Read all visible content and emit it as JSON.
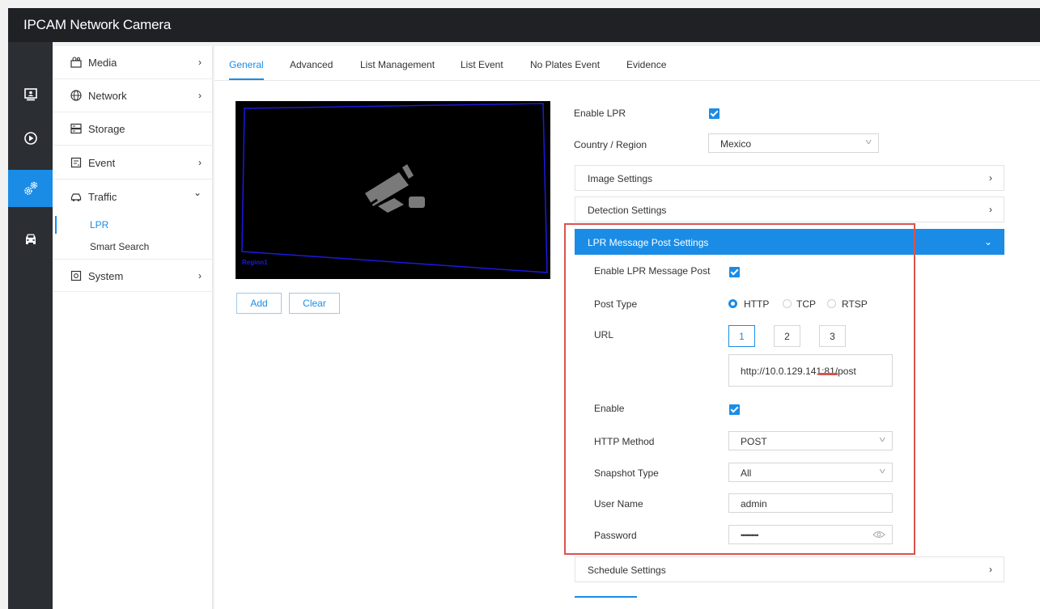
{
  "app": {
    "title": "IPCAM Network Camera"
  },
  "rail": [
    {
      "icon": "monitor-icon"
    },
    {
      "icon": "playback-icon"
    },
    {
      "icon": "settings-gears-icon"
    },
    {
      "icon": "vehicle-icon"
    }
  ],
  "menu": {
    "items": [
      {
        "label": "Media",
        "icon": "camera-media-icon",
        "chevron": "›"
      },
      {
        "label": "Network",
        "icon": "globe-icon",
        "chevron": "›"
      },
      {
        "label": "Storage",
        "icon": "storage-icon",
        "chevron": ""
      },
      {
        "label": "Event",
        "icon": "event-icon",
        "chevron": "›"
      },
      {
        "label": "Traffic",
        "icon": "car-icon",
        "chevron": "⌄"
      },
      {
        "label": "System",
        "icon": "system-icon",
        "chevron": "›"
      }
    ],
    "traffic_sub": [
      {
        "label": "LPR",
        "active": true
      },
      {
        "label": "Smart Search",
        "active": false
      }
    ]
  },
  "tabs": [
    {
      "label": "General",
      "active": true
    },
    {
      "label": "Advanced"
    },
    {
      "label": "List Management"
    },
    {
      "label": "List Event"
    },
    {
      "label": "No Plates Event"
    },
    {
      "label": "Evidence"
    }
  ],
  "video": {
    "region_label": "Region1"
  },
  "actions": {
    "add": "Add",
    "clear": "Clear"
  },
  "lpr": {
    "enable_label": "Enable LPR",
    "enable_checked": true,
    "country_label": "Country / Region",
    "country_value": "Mexico"
  },
  "panels": {
    "image": "Image Settings",
    "detection": "Detection Settings",
    "post": "LPR Message Post Settings",
    "schedule": "Schedule Settings"
  },
  "post": {
    "enable_label": "Enable LPR Message Post",
    "enable_checked": true,
    "type_label": "Post Type",
    "types": [
      "HTTP",
      "TCP",
      "RTSP"
    ],
    "type_selected": "HTTP",
    "url_label": "URL",
    "url_tabs": [
      "1",
      "2",
      "3"
    ],
    "url_selected": "1",
    "url_value": "http://10.0.129.141:81/post",
    "enable2_label": "Enable",
    "enable2_checked": true,
    "method_label": "HTTP Method",
    "method_value": "POST",
    "snapshot_label": "Snapshot Type",
    "snapshot_value": "All",
    "user_label": "User Name",
    "user_value": "admin",
    "password_label": "Password",
    "password_value": "••••••••••"
  },
  "colors": {
    "accent": "#1a8ce6",
    "highlight": "#d9534f",
    "header": "#1f2125",
    "rail": "#2b2e33"
  }
}
